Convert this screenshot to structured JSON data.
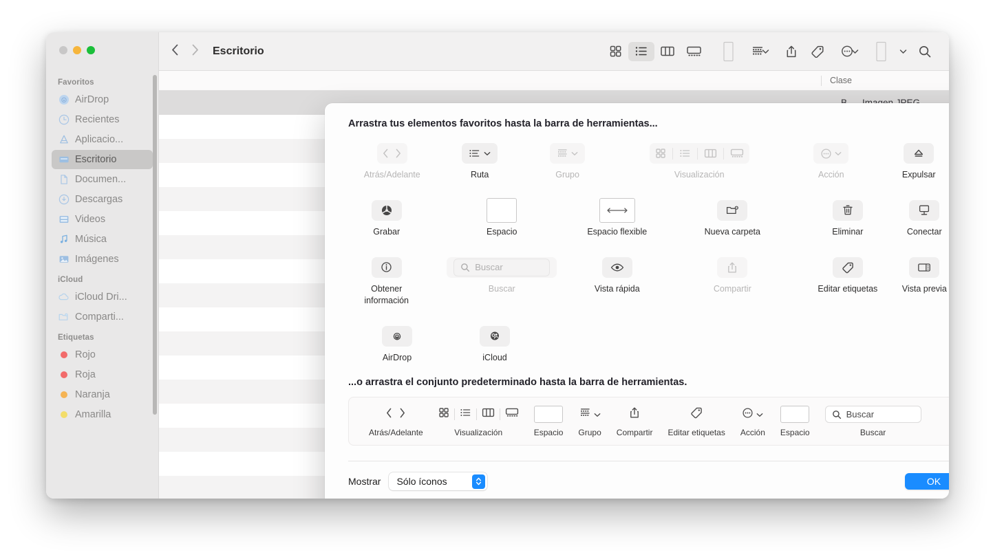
{
  "window": {
    "traffic_lights": [
      "close-gray",
      "minimize-yellow",
      "zoom-green"
    ]
  },
  "toolbar": {
    "back_icon": "chevron-left-icon",
    "forward_icon": "chevron-right-icon",
    "title": "Escritorio",
    "buttons": [
      {
        "name": "icon-view",
        "icon": "grid-icon",
        "active": false
      },
      {
        "name": "list-view",
        "icon": "list-icon",
        "active": true
      },
      {
        "name": "column-view",
        "icon": "columns-icon",
        "active": false
      },
      {
        "name": "gallery-view",
        "icon": "gallery-icon",
        "active": false
      },
      {
        "name": "space",
        "icon": "empty-box-icon",
        "active": false
      },
      {
        "name": "group",
        "icon": "group-icon",
        "active": false
      },
      {
        "name": "share",
        "icon": "share-icon",
        "active": false
      },
      {
        "name": "tags",
        "icon": "tag-icon",
        "active": false
      },
      {
        "name": "action",
        "icon": "ellipsis-circle-icon",
        "active": false
      },
      {
        "name": "space2",
        "icon": "empty-box-icon",
        "active": false
      },
      {
        "name": "search",
        "icon": "search-icon",
        "active": false
      }
    ]
  },
  "sidebar": {
    "sections": [
      {
        "title": "Favoritos",
        "items": [
          {
            "label": "AirDrop",
            "icon": "airdrop-icon",
            "selected": false
          },
          {
            "label": "Recientes",
            "icon": "clock-icon",
            "selected": false
          },
          {
            "label": "Aplicacio...",
            "icon": "applications-icon",
            "selected": false
          },
          {
            "label": "Escritorio",
            "icon": "desktop-icon",
            "selected": true
          },
          {
            "label": "Documen...",
            "icon": "document-icon",
            "selected": false
          },
          {
            "label": "Descargas",
            "icon": "downloads-icon",
            "selected": false
          },
          {
            "label": "Videos",
            "icon": "video-icon",
            "selected": false
          },
          {
            "label": "Música",
            "icon": "music-note-icon",
            "selected": false
          },
          {
            "label": "Imágenes",
            "icon": "photos-icon",
            "selected": false
          }
        ]
      },
      {
        "title": "iCloud",
        "items": [
          {
            "label": "iCloud Dri...",
            "icon": "cloud-icon",
            "selected": false
          },
          {
            "label": "Comparti...",
            "icon": "shared-folder-icon",
            "selected": false
          }
        ]
      },
      {
        "title": "Etiquetas",
        "items": [
          {
            "label": "Rojo",
            "icon": "tag-dot-red",
            "color": "#f26b6b",
            "selected": false
          },
          {
            "label": "Roja",
            "icon": "tag-dot-red",
            "color": "#f26b6b",
            "selected": false
          },
          {
            "label": "Naranja",
            "icon": "tag-dot-orange",
            "color": "#f5b454",
            "selected": false
          },
          {
            "label": "Amarilla",
            "icon": "tag-dot-yellow",
            "color": "#f3dd6a",
            "selected": false
          }
        ]
      }
    ]
  },
  "file_list": {
    "columns": [
      "Clase"
    ],
    "rows": [
      {
        "size": "B",
        "clase": "Imagen JPEG",
        "selected": true
      }
    ]
  },
  "sheet": {
    "heading_top": "Arrastra tus elementos favoritos hasta la barra de herramientas...",
    "heading_bottom": "...o arrastra el conjunto predeterminado hasta la barra de herramientas.",
    "palette": [
      [
        {
          "label": "Atrás/Adelante",
          "icon": "back-forward-icon",
          "dim": true
        },
        {
          "label": "Ruta",
          "icon": "path-icon",
          "dim": false
        },
        {
          "label": "Grupo",
          "icon": "group-icon",
          "dim": true
        },
        {
          "label": "Visualización",
          "icon": "view-modes-icon",
          "dim": true
        },
        {
          "label": "Acción",
          "icon": "ellipsis-circle-icon",
          "dim": true
        },
        {
          "label": "Expulsar",
          "icon": "eject-icon",
          "dim": false
        }
      ],
      [
        {
          "label": "Grabar",
          "icon": "burn-icon",
          "dim": false
        },
        {
          "label": "Espacio",
          "icon": "space-box-icon",
          "dim": false
        },
        {
          "label": "Espacio flexible",
          "icon": "flexible-space-icon",
          "dim": false
        },
        {
          "label": "Nueva carpeta",
          "icon": "new-folder-icon",
          "dim": false
        },
        {
          "label": "Eliminar",
          "icon": "trash-icon",
          "dim": false
        },
        {
          "label": "Conectar",
          "icon": "connect-server-icon",
          "dim": false
        }
      ],
      [
        {
          "label": "Obtener información",
          "icon": "info-circle-icon",
          "dim": false
        },
        {
          "label": "Buscar",
          "icon": "search-field-icon",
          "dim": true,
          "placeholder": "Buscar"
        },
        {
          "label": "Vista rápida",
          "icon": "eye-icon",
          "dim": false
        },
        {
          "label": "Compartir",
          "icon": "share-icon",
          "dim": true
        },
        {
          "label": "Editar etiquetas",
          "icon": "tag-icon",
          "dim": true
        },
        {
          "label": "Vista previa",
          "icon": "preview-panel-icon",
          "dim": false
        }
      ],
      [
        {
          "label": "AirDrop",
          "icon": "airdrop-icon",
          "dim": false
        },
        {
          "label": "iCloud",
          "icon": "icloud-share-icon",
          "dim": false
        }
      ]
    ],
    "default_set": [
      {
        "label": "Atrás/Adelante",
        "icons": [
          "chevron-left-icon",
          "chevron-right-icon"
        ]
      },
      {
        "label": "Visualización",
        "icons": [
          "grid-icon",
          "list-icon",
          "columns-icon",
          "gallery-icon"
        ]
      },
      {
        "label": "Espacio",
        "icons": [
          "space-box-icon"
        ]
      },
      {
        "label": "Grupo",
        "icons": [
          "group-icon"
        ]
      },
      {
        "label": "Compartir",
        "icons": [
          "share-icon"
        ]
      },
      {
        "label": "Editar etiquetas",
        "icons": [
          "tag-icon"
        ]
      },
      {
        "label": "Acción",
        "icons": [
          "ellipsis-circle-icon"
        ]
      },
      {
        "label": "Espacio",
        "icons": [
          "space-box-icon"
        ]
      },
      {
        "label": "Buscar",
        "icons": [
          "search-field-icon"
        ],
        "placeholder": "Buscar"
      }
    ],
    "footer": {
      "show_label": "Mostrar",
      "select_value": "Sólo íconos",
      "ok_label": "OK"
    }
  },
  "colors": {
    "accent": "#1a8cff",
    "sidebar_bg": "#e9e8e8",
    "toolbar_bg": "#f2f1f1"
  }
}
